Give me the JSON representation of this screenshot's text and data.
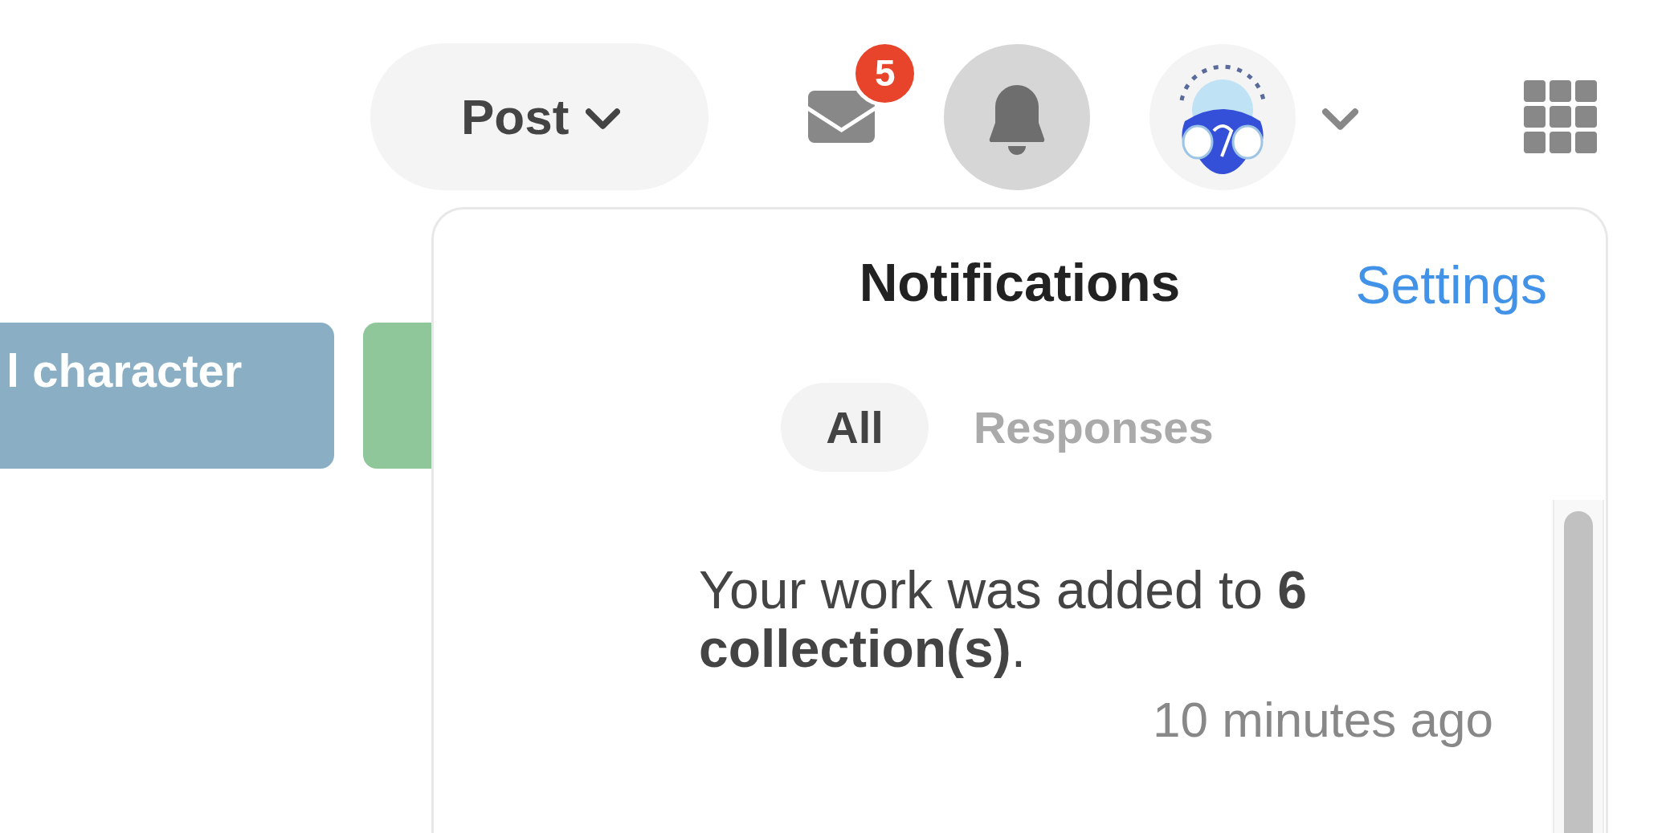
{
  "header": {
    "post_button": {
      "label": "Post"
    },
    "messages": {
      "unread_count": "5"
    },
    "notifications_button": {
      "selected": true
    }
  },
  "cards": [
    {
      "label": "l character",
      "color": "#8aafc4"
    },
    {
      "color": "#8fc79b"
    }
  ],
  "notifications_panel": {
    "title": "Notifications",
    "settings_link": "Settings",
    "tabs": [
      {
        "label": "All",
        "selected": true
      },
      {
        "label": "Responses",
        "selected": false
      }
    ],
    "items": [
      {
        "message": "Your work was added to **6 collection(s)**.",
        "time": "10 minutes ago"
      }
    ]
  }
}
